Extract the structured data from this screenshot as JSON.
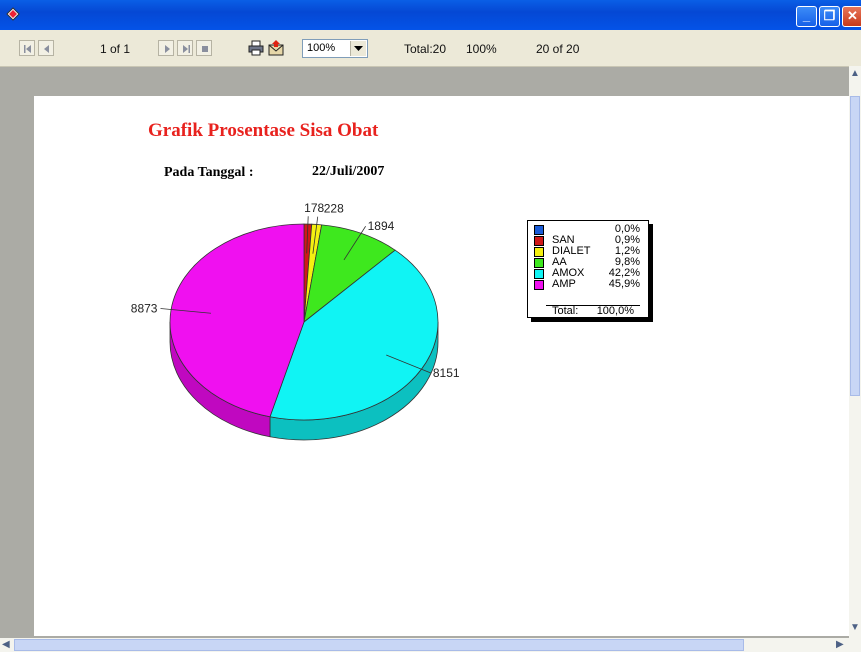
{
  "toolbar": {
    "page_info": "1 of 1",
    "zoom": "100%",
    "total": "Total:20",
    "percent": "100%",
    "record_info": "20 of 20"
  },
  "report": {
    "title": "Grafik Prosentase Sisa Obat",
    "date_label": "Pada Tanggal :",
    "date_value": "22/Juli/2007"
  },
  "chart_data": {
    "type": "pie",
    "title": "",
    "categories": [
      "",
      "SAN",
      "DIALET",
      "AA",
      "AMOX",
      "AMP"
    ],
    "values": [
      0,
      178,
      228,
      1894,
      8151,
      8873
    ],
    "percentages": [
      "0,0%",
      "0,9%",
      "1,2%",
      "9,8%",
      "42,2%",
      "45,9%"
    ],
    "colors": [
      "#1a5cd8",
      "#d01818",
      "#f5f010",
      "#3ee81e",
      "#10f4f4",
      "#f010f0"
    ],
    "side_colors": [
      "#10399a",
      "#a01010",
      "#c8c400",
      "#28b012",
      "#0cc0c0",
      "#c008c0"
    ],
    "data_labels": [
      "",
      "178",
      "228",
      "1894",
      "8151",
      "8873"
    ],
    "legend": {
      "placement": "right",
      "total_label": "Total:",
      "total_value": "100,0%"
    }
  }
}
